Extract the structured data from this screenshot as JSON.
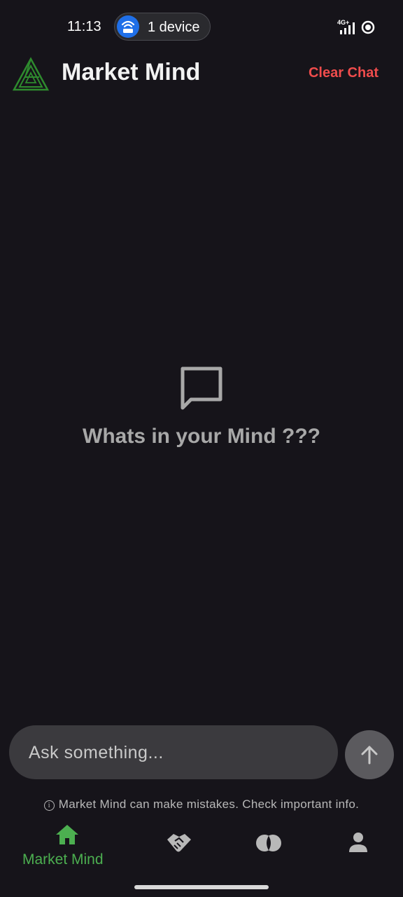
{
  "status_bar": {
    "time": "11:13",
    "hotspot_label": "1 device",
    "network": "4G+"
  },
  "header": {
    "title": "Market Mind",
    "clear_chat_label": "Clear Chat"
  },
  "empty_state": {
    "message": "Whats in your Mind ???"
  },
  "composer": {
    "placeholder": "Ask something...",
    "value": ""
  },
  "disclaimer": {
    "text": "Market Mind can make mistakes. Check important info."
  },
  "bottom_nav": {
    "items": [
      {
        "label": "Market Mind",
        "icon": "home-icon",
        "active": true
      },
      {
        "label": "",
        "icon": "handshake-icon",
        "active": false
      },
      {
        "label": "",
        "icon": "circles-icon",
        "active": false
      },
      {
        "label": "",
        "icon": "person-icon",
        "active": false
      }
    ]
  },
  "colors": {
    "background": "#16141a",
    "accent_green": "#4caf50",
    "clear_chat_red": "#ef4c4c",
    "input_bg": "#3b3a3e",
    "send_bg": "#5b5a5e",
    "hotspot_blue": "#1f6fe8"
  }
}
